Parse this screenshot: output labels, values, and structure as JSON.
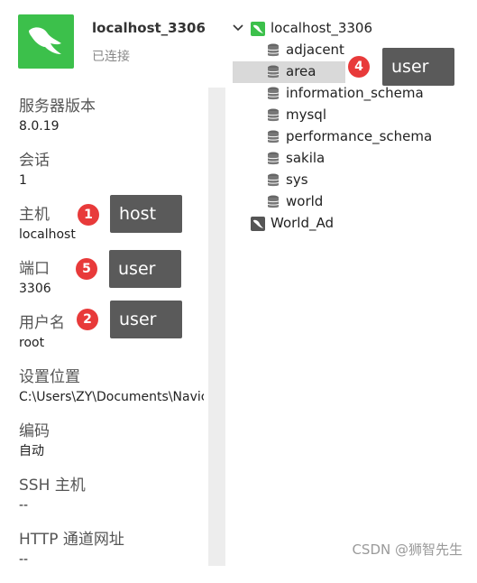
{
  "connection": {
    "title": "localhost_3306",
    "status": "已连接",
    "icon": "mysql-dolphin-icon"
  },
  "info": [
    {
      "label": "服务器版本",
      "value": "8.0.19"
    },
    {
      "label": "会话",
      "value": "1"
    },
    {
      "label": "主机",
      "value": "localhost"
    },
    {
      "label": "端口",
      "value": "3306"
    },
    {
      "label": "用户名",
      "value": "root"
    },
    {
      "label": "设置位置",
      "value": "C:\\Users\\ZY\\Documents\\Navicat"
    },
    {
      "label": "编码",
      "value": "自动"
    },
    {
      "label": "SSH 主机",
      "value": "--"
    },
    {
      "label": "HTTP 通道网址",
      "value": "--"
    }
  ],
  "tree": {
    "connection": "localhost_3306",
    "databases": [
      "adjacent",
      "area",
      "information_schema",
      "mysql",
      "performance_schema",
      "sakila",
      "sys",
      "world"
    ],
    "selected": "area",
    "other_connection": "World_Ad"
  },
  "annotations": [
    {
      "number": "1",
      "text": "host"
    },
    {
      "number": "5",
      "text": "user"
    },
    {
      "number": "2",
      "text": "user"
    },
    {
      "number": "4",
      "text": "user"
    }
  ],
  "watermark": "CSDN @狮智先生",
  "colors": {
    "accent_green": "#3cc04b",
    "badge_red": "#e83a3a",
    "tag_gray": "#5a5a5a",
    "selected_row": "#d9d9d9"
  }
}
